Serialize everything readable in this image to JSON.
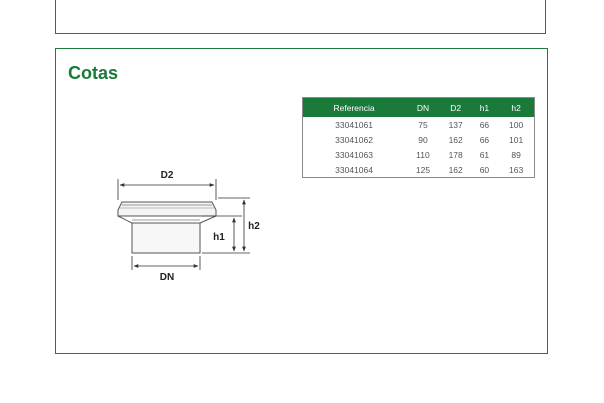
{
  "section": {
    "title": "Cotas"
  },
  "table": {
    "headers": [
      "Referencia",
      "DN",
      "D2",
      "h1",
      "h2"
    ],
    "rows": [
      [
        "33041061",
        "75",
        "137",
        "66",
        "100"
      ],
      [
        "33041062",
        "90",
        "162",
        "66",
        "101"
      ],
      [
        "33041063",
        "110",
        "178",
        "61",
        "89"
      ],
      [
        "33041064",
        "125",
        "162",
        "60",
        "163"
      ]
    ]
  },
  "drawing": {
    "labels": {
      "d2": "D2",
      "dn": "DN",
      "h1": "h1",
      "h2": "h2"
    }
  },
  "colors": {
    "accent": "#1a7a3a",
    "border": "#1f7a3c"
  }
}
